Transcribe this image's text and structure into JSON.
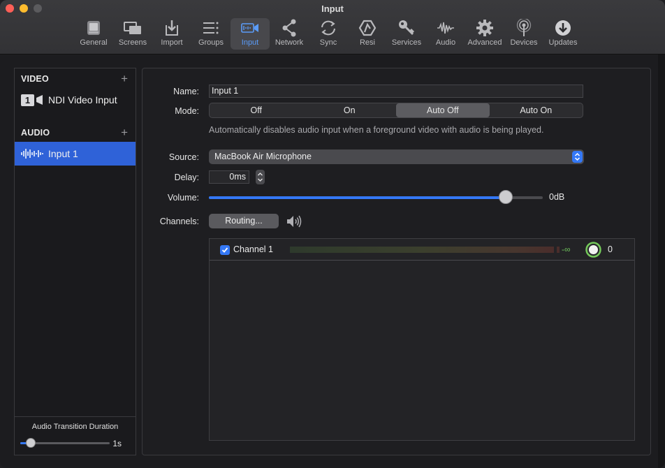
{
  "window": {
    "title": "Input"
  },
  "toolbar": {
    "items": [
      {
        "label": "General",
        "icon": "general-icon"
      },
      {
        "label": "Screens",
        "icon": "screens-icon"
      },
      {
        "label": "Import",
        "icon": "import-icon"
      },
      {
        "label": "Groups",
        "icon": "groups-icon"
      },
      {
        "label": "Input",
        "icon": "input-icon",
        "active": true
      },
      {
        "label": "Network",
        "icon": "network-icon"
      },
      {
        "label": "Sync",
        "icon": "sync-icon"
      },
      {
        "label": "Resi",
        "icon": "resi-icon"
      },
      {
        "label": "Services",
        "icon": "key-icon"
      },
      {
        "label": "Audio",
        "icon": "waveform-icon"
      },
      {
        "label": "Advanced",
        "icon": "gear-icon"
      },
      {
        "label": "Devices",
        "icon": "antenna-icon"
      },
      {
        "label": "Updates",
        "icon": "download-icon"
      }
    ],
    "accent": "#5b9cf8"
  },
  "sidebar": {
    "video_header": "VIDEO",
    "audio_header": "AUDIO",
    "add_symbol": "+",
    "video_items": [
      {
        "badge": "1",
        "label": "NDI Video Input"
      }
    ],
    "audio_items": [
      {
        "label": "Input 1",
        "selected": true
      }
    ],
    "selection_color": "#2f62d8",
    "footer": {
      "label": "Audio Transition Duration",
      "value": "1s",
      "level": 0.12
    }
  },
  "form": {
    "name_label": "Name:",
    "name_value": "Input 1",
    "mode_label": "Mode:",
    "mode_options": [
      "Off",
      "On",
      "Auto Off",
      "Auto On"
    ],
    "mode_selected": "Auto Off",
    "mode_description": "Automatically disables audio input when a foreground video with audio is being played.",
    "source_label": "Source:",
    "source_value": "MacBook Air Microphone",
    "delay_label": "Delay:",
    "delay_value": "0ms",
    "volume_label": "Volume:",
    "volume_value": "0dB",
    "volume_level": 0.89,
    "channels_label": "Channels:",
    "routing_button": "Routing...",
    "channels": [
      {
        "name": "Channel 1",
        "checked": true,
        "level_db": "-∞",
        "gain": "0"
      }
    ]
  }
}
